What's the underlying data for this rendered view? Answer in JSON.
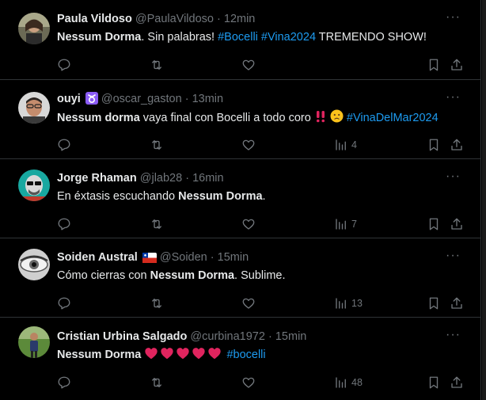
{
  "tweets": [
    {
      "name": "Paula Vildoso",
      "handle": "@PaulaVildoso",
      "time": "12min",
      "text_bold": "Nessum Dorma",
      "text_rest": ". Sin palabras! ",
      "tags": [
        "#Bocelli",
        "#Vina2024"
      ],
      "text_after": " TREMENDO SHOW!",
      "views": "",
      "avatar_icon": "woman-photo-avatar"
    },
    {
      "name": "ouyi",
      "name_badge": "taurus-emoji",
      "handle": "@oscar_gaston",
      "time": "13min",
      "text_bold": "Nessum dorma",
      "text_rest": " vaya final con Bocelli a todo coro ",
      "emojis": [
        "double-exclamation-emoji",
        "sad-face-emoji"
      ],
      "tags": [
        "#VinaDelMar2024"
      ],
      "views": "4",
      "avatar_icon": "man-photo-avatar"
    },
    {
      "name": "Jorge Rhaman",
      "handle": "@jlab28",
      "time": "16min",
      "text_pre": "En éxtasis escuchando ",
      "text_bold": "Nessum Dorma",
      "text_rest": ".",
      "views": "7",
      "avatar_icon": "illustrated-man-avatar"
    },
    {
      "name": "Soiden Austral",
      "name_badge": "chile-flag-emoji",
      "handle": "@Soiden",
      "time": "15min",
      "text_pre": "Cómo cierras con ",
      "text_bold": "Nessum Dorma",
      "text_rest": ". Sublime.",
      "views": "13",
      "avatar_icon": "eye-photo-avatar"
    },
    {
      "name": "Cristian Urbina Salgado",
      "handle": "@curbina1972",
      "time": "15min",
      "text_bold": "Nessum Dorma",
      "hearts": 5,
      "tags": [
        "#bocelli"
      ],
      "views": "48",
      "avatar_icon": "person-outdoor-avatar"
    }
  ],
  "separator": "·",
  "more_label": "···",
  "colors": {
    "bg": "#000000",
    "text": "#e7e9ea",
    "muted": "#71767b",
    "link": "#1d9bf0",
    "border": "#2f3336",
    "heart": "#e0245e"
  }
}
